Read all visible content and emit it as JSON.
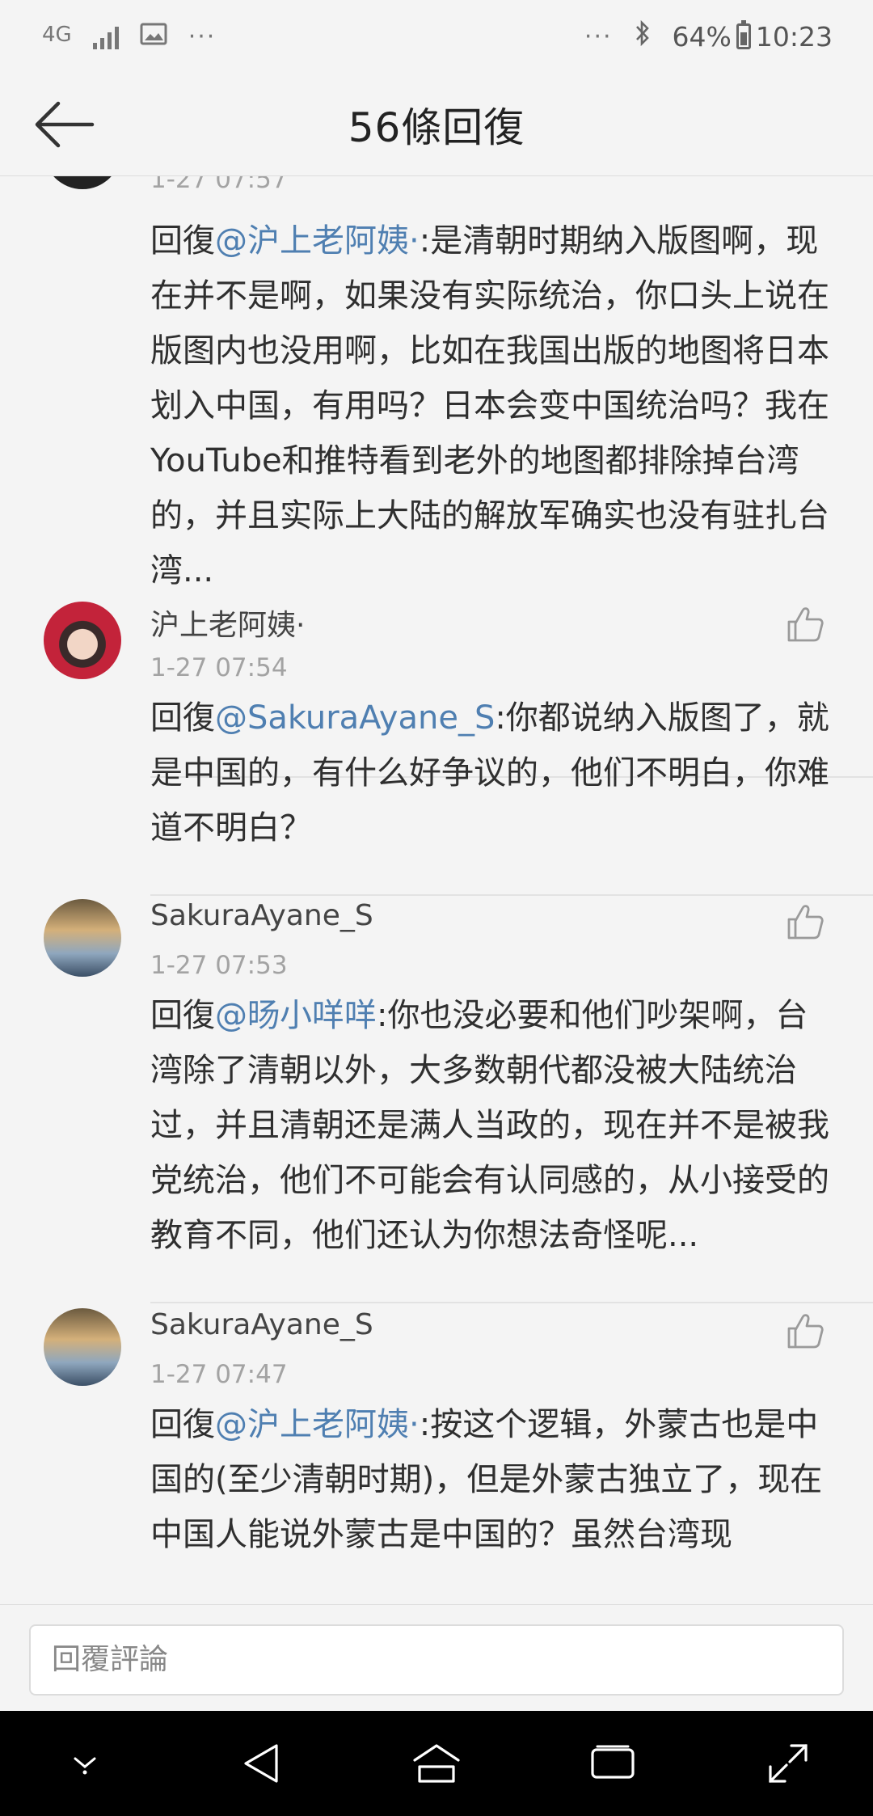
{
  "status_bar": {
    "network": "4G",
    "dots": "···",
    "right_dots": "···",
    "battery": "64%",
    "time": "10:23"
  },
  "header": {
    "title": "56條回復",
    "back_icon": "arrow-left-icon"
  },
  "comments": [
    {
      "timestamp": "1-27 07:57",
      "reply_prefix": "回復",
      "mention": "@沪上老阿姨·",
      "text": ":是清朝时期纳入版图啊，现在并不是啊，如果没有实际统治，你口头上说在版图内也没用啊，比如在我国出版的地图将日本划入中国，有用吗？日本会变中国统治吗？我在YouTube和推特看到老外的地图都排除掉台湾的，并且实际上大陆的解放军确实也没有驻扎台湾..."
    },
    {
      "username": "沪上老阿姨·",
      "timestamp": "1-27 07:54",
      "reply_prefix": "回復",
      "mention": "@SakuraAyane_S",
      "text": ":你都说纳入版图了，就是中国的，有什么好争议的，他们不明白，你难道不明白？"
    },
    {
      "username": "SakuraAyane_S",
      "timestamp": "1-27 07:53",
      "reply_prefix": "回復",
      "mention": "@旸小咩咩",
      "text": ":你也没必要和他们吵架啊，台湾除了清朝以外，大多数朝代都没被大陆统治过，并且清朝还是满人当政的，现在并不是被我党统治，他们不可能会有认同感的，从小接受的教育不同，他们还认为你想法奇怪呢..."
    },
    {
      "username": "SakuraAyane_S",
      "timestamp": "1-27 07:47",
      "reply_prefix": "回復",
      "mention": "@沪上老阿姨·",
      "text": ":按这个逻辑，外蒙古也是中国的(至少清朝时期)，但是外蒙古独立了，现在中国人能说外蒙古是中国的？虽然台湾现"
    }
  ],
  "reply_bar": {
    "placeholder": "回覆評論"
  },
  "nav_bar": {
    "icons": [
      "chevron-down-icon",
      "back-triangle-icon",
      "home-icon",
      "recents-icon",
      "expand-icon"
    ]
  },
  "colors": {
    "mention": "#4f7fb1",
    "background": "#f4f4f4",
    "nav_background": "#000000"
  }
}
